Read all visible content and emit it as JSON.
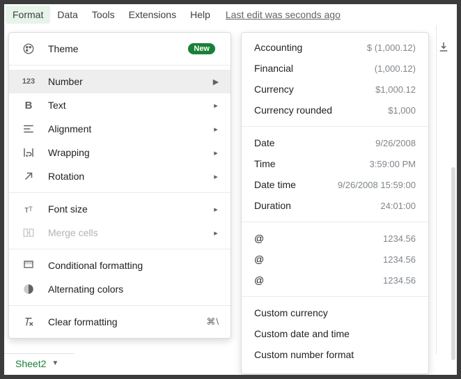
{
  "menubar": {
    "items": [
      "Format",
      "Data",
      "Tools",
      "Extensions",
      "Help"
    ],
    "last_edit": "Last edit was seconds ago"
  },
  "badge_new": "New",
  "format_menu": {
    "theme": "Theme",
    "number": "Number",
    "text": "Text",
    "alignment": "Alignment",
    "wrapping": "Wrapping",
    "rotation": "Rotation",
    "font_size": "Font size",
    "merge_cells": "Merge cells",
    "conditional_formatting": "Conditional formatting",
    "alternating_colors": "Alternating colors",
    "clear_formatting": "Clear formatting",
    "clear_shortcut": "⌘\\"
  },
  "number_submenu": {
    "accounting": {
      "name": "Accounting",
      "example": "$ (1,000.12)"
    },
    "financial": {
      "name": "Financial",
      "example": "(1,000.12)"
    },
    "currency": {
      "name": "Currency",
      "example": "$1,000.12"
    },
    "currency_rounded": {
      "name": "Currency rounded",
      "example": "$1,000"
    },
    "date": {
      "name": "Date",
      "example": "9/26/2008"
    },
    "time": {
      "name": "Time",
      "example": "3:59:00 PM"
    },
    "datetime": {
      "name": "Date time",
      "example": "9/26/2008 15:59:00"
    },
    "duration": {
      "name": "Duration",
      "example": "24:01:00"
    },
    "at1": {
      "name": "@",
      "example": "1234.56"
    },
    "at2": {
      "name": "@",
      "example": "1234.56"
    },
    "at3": {
      "name": "@",
      "example": "1234.56"
    },
    "custom_currency": "Custom currency",
    "custom_datetime": "Custom date and time",
    "custom_number": "Custom number format"
  },
  "sheet_tab": "Sheet2"
}
